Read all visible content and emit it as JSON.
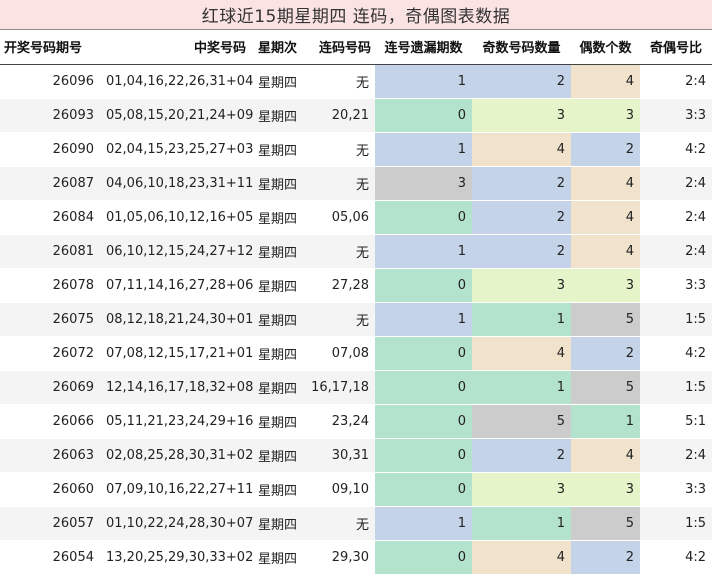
{
  "title": "红球近15期星期四 连码，奇偶图表数据",
  "colors": {
    "blue": "#c5d3e8",
    "green": "#b3e2cd",
    "lime": "#e6f5c9",
    "peach": "#f1e2cc",
    "gray": "#cccccc",
    "plain_even": "#f4f4f4",
    "plain_odd": "#ffffff"
  },
  "columns": [
    "开奖号码期号",
    "中奖号码",
    "星期次",
    "连码号码",
    "连号遗漏期数",
    "奇数号码数量",
    "偶数个数",
    "奇偶号比"
  ],
  "rows": [
    {
      "issue": "26096",
      "numbers": "01,04,16,22,26,31+04",
      "weekday": "星期四",
      "consecutive": "无",
      "miss": "1",
      "odd": "2",
      "even": "4",
      "ratio": "2:4",
      "c_miss": "blue",
      "c_odd": "blue",
      "c_even": "peach"
    },
    {
      "issue": "26093",
      "numbers": "05,08,15,20,21,24+09",
      "weekday": "星期四",
      "consecutive": "20,21",
      "miss": "0",
      "odd": "3",
      "even": "3",
      "ratio": "3:3",
      "c_miss": "green",
      "c_odd": "lime",
      "c_even": "lime"
    },
    {
      "issue": "26090",
      "numbers": "02,04,15,23,25,27+03",
      "weekday": "星期四",
      "consecutive": "无",
      "miss": "1",
      "odd": "4",
      "even": "2",
      "ratio": "4:2",
      "c_miss": "blue",
      "c_odd": "peach",
      "c_even": "blue"
    },
    {
      "issue": "26087",
      "numbers": "04,06,10,18,23,31+11",
      "weekday": "星期四",
      "consecutive": "无",
      "miss": "3",
      "odd": "2",
      "even": "4",
      "ratio": "2:4",
      "c_miss": "gray",
      "c_odd": "blue",
      "c_even": "peach"
    },
    {
      "issue": "26084",
      "numbers": "01,05,06,10,12,16+05",
      "weekday": "星期四",
      "consecutive": "05,06",
      "miss": "0",
      "odd": "2",
      "even": "4",
      "ratio": "2:4",
      "c_miss": "green",
      "c_odd": "blue",
      "c_even": "peach"
    },
    {
      "issue": "26081",
      "numbers": "06,10,12,15,24,27+12",
      "weekday": "星期四",
      "consecutive": "无",
      "miss": "1",
      "odd": "2",
      "even": "4",
      "ratio": "2:4",
      "c_miss": "blue",
      "c_odd": "blue",
      "c_even": "peach"
    },
    {
      "issue": "26078",
      "numbers": "07,11,14,16,27,28+06",
      "weekday": "星期四",
      "consecutive": "27,28",
      "miss": "0",
      "odd": "3",
      "even": "3",
      "ratio": "3:3",
      "c_miss": "green",
      "c_odd": "lime",
      "c_even": "lime"
    },
    {
      "issue": "26075",
      "numbers": "08,12,18,21,24,30+01",
      "weekday": "星期四",
      "consecutive": "无",
      "miss": "1",
      "odd": "1",
      "even": "5",
      "ratio": "1:5",
      "c_miss": "blue",
      "c_odd": "green",
      "c_even": "gray"
    },
    {
      "issue": "26072",
      "numbers": "07,08,12,15,17,21+01",
      "weekday": "星期四",
      "consecutive": "07,08",
      "miss": "0",
      "odd": "4",
      "even": "2",
      "ratio": "4:2",
      "c_miss": "green",
      "c_odd": "peach",
      "c_even": "blue"
    },
    {
      "issue": "26069",
      "numbers": "12,14,16,17,18,32+08",
      "weekday": "星期四",
      "consecutive": "16,17,18",
      "miss": "0",
      "odd": "1",
      "even": "5",
      "ratio": "1:5",
      "c_miss": "green",
      "c_odd": "green",
      "c_even": "gray"
    },
    {
      "issue": "26066",
      "numbers": "05,11,21,23,24,29+16",
      "weekday": "星期四",
      "consecutive": "23,24",
      "miss": "0",
      "odd": "5",
      "even": "1",
      "ratio": "5:1",
      "c_miss": "green",
      "c_odd": "gray",
      "c_even": "green"
    },
    {
      "issue": "26063",
      "numbers": "02,08,25,28,30,31+02",
      "weekday": "星期四",
      "consecutive": "30,31",
      "miss": "0",
      "odd": "2",
      "even": "4",
      "ratio": "2:4",
      "c_miss": "green",
      "c_odd": "blue",
      "c_even": "peach"
    },
    {
      "issue": "26060",
      "numbers": "07,09,10,16,22,27+11",
      "weekday": "星期四",
      "consecutive": "09,10",
      "miss": "0",
      "odd": "3",
      "even": "3",
      "ratio": "3:3",
      "c_miss": "green",
      "c_odd": "lime",
      "c_even": "lime"
    },
    {
      "issue": "26057",
      "numbers": "01,10,22,24,28,30+07",
      "weekday": "星期四",
      "consecutive": "无",
      "miss": "1",
      "odd": "1",
      "even": "5",
      "ratio": "1:5",
      "c_miss": "blue",
      "c_odd": "green",
      "c_even": "gray"
    },
    {
      "issue": "26054",
      "numbers": "13,20,25,29,30,33+02",
      "weekday": "星期四",
      "consecutive": "29,30",
      "miss": "0",
      "odd": "4",
      "even": "2",
      "ratio": "4:2",
      "c_miss": "green",
      "c_odd": "peach",
      "c_even": "blue"
    }
  ]
}
